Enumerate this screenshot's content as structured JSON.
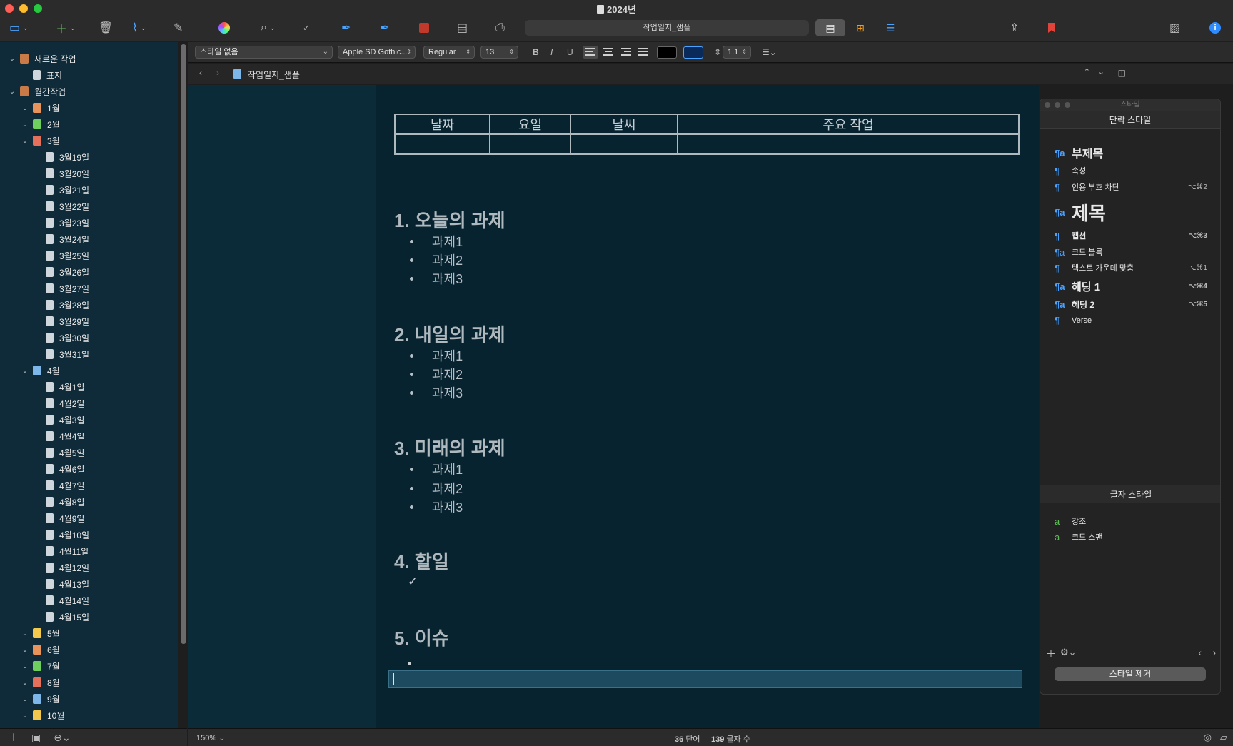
{
  "window": {
    "title": "2024년",
    "document_field": "작업일지_샘플"
  },
  "toolbar": {
    "icons": [
      "sidebar-icon",
      "add-icon",
      "trash-icon",
      "paperclip-icon",
      "compose-icon",
      "color-wheel-icon",
      "search-icon",
      "spellcheck-icon",
      "pen-icon",
      "pen-alt-icon",
      "flashcard-icon",
      "keyboard-icon",
      "print-icon",
      "page-view-icon",
      "grid-view-icon",
      "outline-view-icon",
      "share-icon",
      "bookmark-icon",
      "compose-mode-icon",
      "info-icon"
    ]
  },
  "sidebar": {
    "items": [
      {
        "label": "새로운 작업",
        "level": 0,
        "icon": "box",
        "expanded": true
      },
      {
        "label": "표지",
        "level": 1,
        "icon": "doc"
      },
      {
        "label": "월간작업",
        "level": 0,
        "icon": "stack",
        "expanded": true
      },
      {
        "label": "1월",
        "level": 1,
        "icon": "orange",
        "expanded": true
      },
      {
        "label": "2월",
        "level": 1,
        "icon": "green",
        "expanded": true
      },
      {
        "label": "3월",
        "level": 1,
        "icon": "red",
        "expanded": true
      },
      {
        "label": "3월19일",
        "level": 2,
        "icon": "sheet"
      },
      {
        "label": "3월20일",
        "level": 2,
        "icon": "sheet"
      },
      {
        "label": "3월21일",
        "level": 2,
        "icon": "sheet"
      },
      {
        "label": "3월22일",
        "level": 2,
        "icon": "sheet"
      },
      {
        "label": "3월23일",
        "level": 2,
        "icon": "sheet"
      },
      {
        "label": "3월24일",
        "level": 2,
        "icon": "sheet"
      },
      {
        "label": "3월25일",
        "level": 2,
        "icon": "sheet"
      },
      {
        "label": "3월26일",
        "level": 2,
        "icon": "sheet"
      },
      {
        "label": "3월27일",
        "level": 2,
        "icon": "sheet"
      },
      {
        "label": "3월28일",
        "level": 2,
        "icon": "sheet"
      },
      {
        "label": "3월29일",
        "level": 2,
        "icon": "sheet"
      },
      {
        "label": "3월30일",
        "level": 2,
        "icon": "sheet"
      },
      {
        "label": "3월31일",
        "level": 2,
        "icon": "sheet"
      },
      {
        "label": "4월",
        "level": 1,
        "icon": "blue",
        "expanded": true
      },
      {
        "label": "4월1일",
        "level": 2,
        "icon": "sheet"
      },
      {
        "label": "4월2일",
        "level": 2,
        "icon": "sheet"
      },
      {
        "label": "4월3일",
        "level": 2,
        "icon": "sheet"
      },
      {
        "label": "4월4일",
        "level": 2,
        "icon": "sheet"
      },
      {
        "label": "4월5일",
        "level": 2,
        "icon": "sheet"
      },
      {
        "label": "4월6일",
        "level": 2,
        "icon": "sheet"
      },
      {
        "label": "4월7일",
        "level": 2,
        "icon": "sheet"
      },
      {
        "label": "4월8일",
        "level": 2,
        "icon": "sheet"
      },
      {
        "label": "4월9일",
        "level": 2,
        "icon": "sheet"
      },
      {
        "label": "4월10일",
        "level": 2,
        "icon": "sheet"
      },
      {
        "label": "4월11일",
        "level": 2,
        "icon": "sheet"
      },
      {
        "label": "4월12일",
        "level": 2,
        "icon": "sheet"
      },
      {
        "label": "4월13일",
        "level": 2,
        "icon": "sheet"
      },
      {
        "label": "4월14일",
        "level": 2,
        "icon": "sheet"
      },
      {
        "label": "4월15일",
        "level": 2,
        "icon": "sheet"
      },
      {
        "label": "5월",
        "level": 1,
        "icon": "yellow",
        "expanded": true
      },
      {
        "label": "6월",
        "level": 1,
        "icon": "orange",
        "expanded": true
      },
      {
        "label": "7월",
        "level": 1,
        "icon": "green",
        "expanded": true
      },
      {
        "label": "8월",
        "level": 1,
        "icon": "red",
        "expanded": true
      },
      {
        "label": "9월",
        "level": 1,
        "icon": "blue",
        "expanded": true
      },
      {
        "label": "10월",
        "level": 1,
        "icon": "yellow",
        "expanded": true
      }
    ]
  },
  "formatbar": {
    "style": "스타일 없음",
    "font": "Apple SD Gothic...",
    "weight": "Regular",
    "size": "13",
    "bold": "B",
    "italic": "I",
    "underline": "U",
    "line_spacing": "1.1",
    "text_color": "#000000",
    "highlight_color": "#0a2a5a"
  },
  "navbar": {
    "doc_title": "작업일지_샘플"
  },
  "document": {
    "table_headers": [
      "날짜",
      "요일",
      "날씨",
      "주요 작업"
    ],
    "sections": [
      {
        "heading": "1. 오늘의 과제",
        "items": [
          "과제1",
          "과제2",
          "과제3"
        ]
      },
      {
        "heading": "2. 내일의 과제",
        "items": [
          "과제1",
          "과제2",
          "과제3"
        ]
      },
      {
        "heading": "3. 미래의 과제",
        "items": [
          "과제1",
          "과제2",
          "과제3"
        ]
      },
      {
        "heading": "4. 할일",
        "items": []
      },
      {
        "heading": "5. 이슈",
        "items": []
      }
    ],
    "checkmark": "✓"
  },
  "styles_panel": {
    "window_title": "스타일",
    "paragraph_header": "단락 스타일",
    "paragraph_styles": [
      {
        "name": "부제목",
        "shortcut": ""
      },
      {
        "name": "속성",
        "shortcut": ""
      },
      {
        "name": "인용 부호 차단",
        "shortcut": "⌥⌘2"
      },
      {
        "name": "제목",
        "shortcut": ""
      },
      {
        "name": "캡션",
        "shortcut": "⌥⌘3"
      },
      {
        "name": "코드 블록",
        "shortcut": ""
      },
      {
        "name": "텍스트 가운데 맞춤",
        "shortcut": "⌥⌘1"
      },
      {
        "name": "헤딩 1",
        "shortcut": "⌥⌘4"
      },
      {
        "name": "헤딩 2",
        "shortcut": "⌥⌘5"
      },
      {
        "name": "Verse",
        "shortcut": ""
      }
    ],
    "character_header": "글자 스타일",
    "character_styles": [
      {
        "name": "강조"
      },
      {
        "name": "코드 스팬"
      }
    ],
    "remove_button": "스타일 제거"
  },
  "statusbar": {
    "zoom": "150%",
    "word_count": "36",
    "word_label": "단어",
    "char_count": "139",
    "char_label": "글자 수"
  }
}
